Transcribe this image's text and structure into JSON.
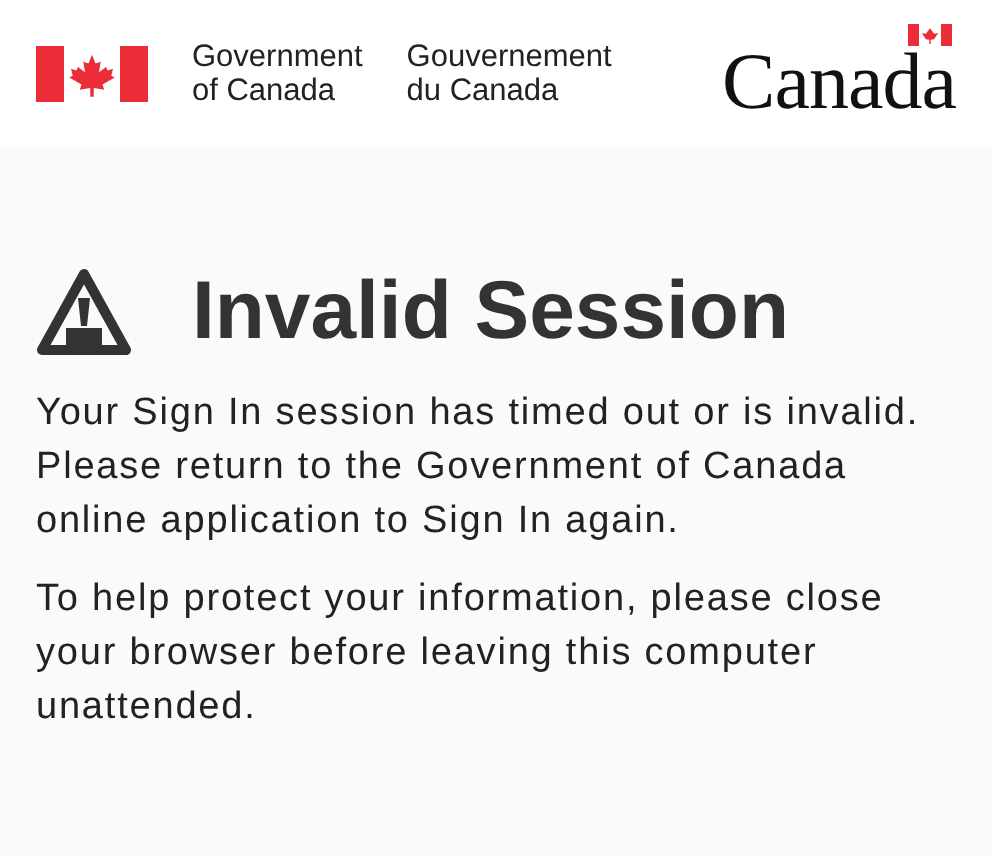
{
  "header": {
    "government_en": "Government\nof Canada",
    "government_fr": "Gouvernement\ndu Canada",
    "wordmark": "Canada"
  },
  "heading": "Invalid Session",
  "paragraphs": [
    "Your Sign In session has timed out or is invalid. Please return to the Government of Canada online application to Sign In again.",
    "To help protect your information, please close your browser before leaving this computer unattended."
  ]
}
